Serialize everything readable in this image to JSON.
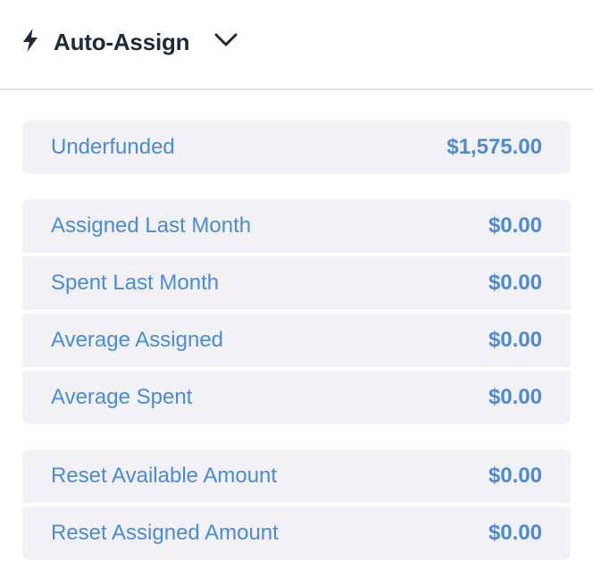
{
  "header": {
    "title": "Auto-Assign",
    "icon": "bolt-icon",
    "toggle_icon": "chevron-down-icon"
  },
  "summary": {
    "label": "Underfunded",
    "value": "$1,575.00"
  },
  "history": [
    {
      "label": "Assigned Last Month",
      "value": "$0.00"
    },
    {
      "label": "Spent Last Month",
      "value": "$0.00"
    },
    {
      "label": "Average Assigned",
      "value": "$0.00"
    },
    {
      "label": "Average Spent",
      "value": "$0.00"
    }
  ],
  "reset": [
    {
      "label": "Reset Available Amount",
      "value": "$0.00"
    },
    {
      "label": "Reset Assigned Amount",
      "value": "$0.00"
    }
  ],
  "colors": {
    "accent": "#4a8bd6",
    "row_background": "#f1f1f6",
    "title": "#1f2a37"
  }
}
